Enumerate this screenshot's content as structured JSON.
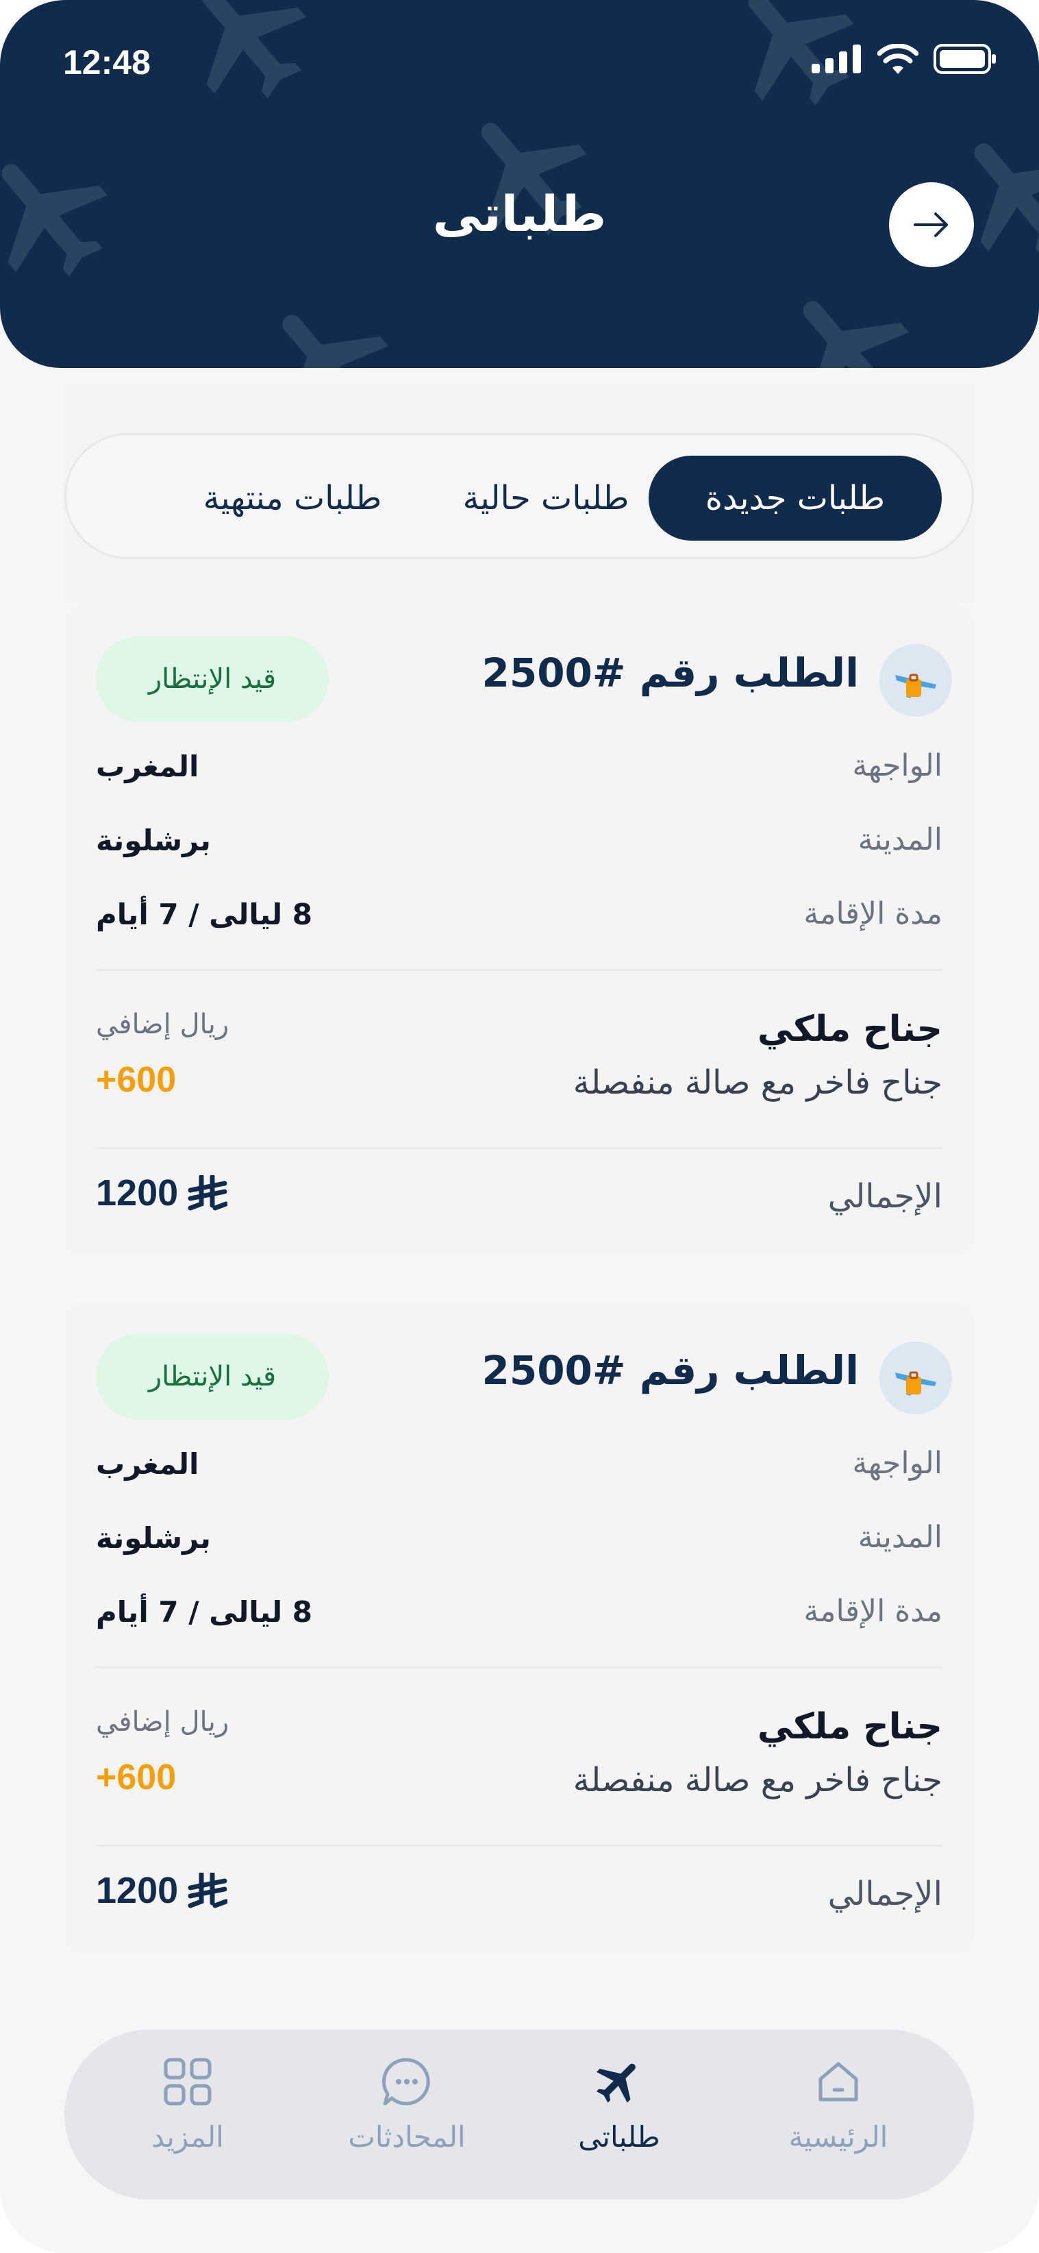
{
  "status_bar": {
    "time": "12:48"
  },
  "header": {
    "title": "طلباتى"
  },
  "tabs": [
    {
      "id": "new",
      "label": "طلبات جديدة",
      "active": true
    },
    {
      "id": "current",
      "label": "طلبات حالية",
      "active": false
    },
    {
      "id": "finished",
      "label": "طلبات منتهية",
      "active": false
    }
  ],
  "orders": [
    {
      "title": "الطلب رقم #2500",
      "status": "قيد الإنتظار",
      "rows": [
        {
          "label": "الواجهة",
          "value": "المغرب"
        },
        {
          "label": "المدينة",
          "value": "برشلونة"
        },
        {
          "label": "مدة الإقامة",
          "value": "8 ليالى / 7 أيام"
        }
      ],
      "suite_name": "جناح ملكي",
      "suite_desc": "جناح فاخر مع صالة منفصلة",
      "extra_label": "ريال إضافي",
      "extra_price": "+600",
      "total_label": "الإجمالي",
      "total_amount": "1200"
    },
    {
      "title": "الطلب رقم #2500",
      "status": "قيد الإنتظار",
      "rows": [
        {
          "label": "الواجهة",
          "value": "المغرب"
        },
        {
          "label": "المدينة",
          "value": "برشلونة"
        },
        {
          "label": "مدة الإقامة",
          "value": "8 ليالى / 7 أيام"
        }
      ],
      "suite_name": "جناح ملكي",
      "suite_desc": "جناح فاخر مع صالة منفصلة",
      "extra_label": "ريال إضافي",
      "extra_price": "+600",
      "total_label": "الإجمالي",
      "total_amount": "1200"
    }
  ],
  "bottom_nav": [
    {
      "id": "home",
      "label": "الرئيسية",
      "icon": "home-icon"
    },
    {
      "id": "orders",
      "label": "طلباتى",
      "icon": "airplane-icon",
      "active": true
    },
    {
      "id": "chats",
      "label": "المحادثات",
      "icon": "chat-icon"
    },
    {
      "id": "more",
      "label": "المزيد",
      "icon": "grid-icon"
    }
  ],
  "colors": {
    "primary": "#112b4c",
    "badge_bg": "#dff7e6",
    "badge_text": "#18703c",
    "accent_orange": "#f59e0b",
    "nav_inactive": "#8ea1ba"
  }
}
